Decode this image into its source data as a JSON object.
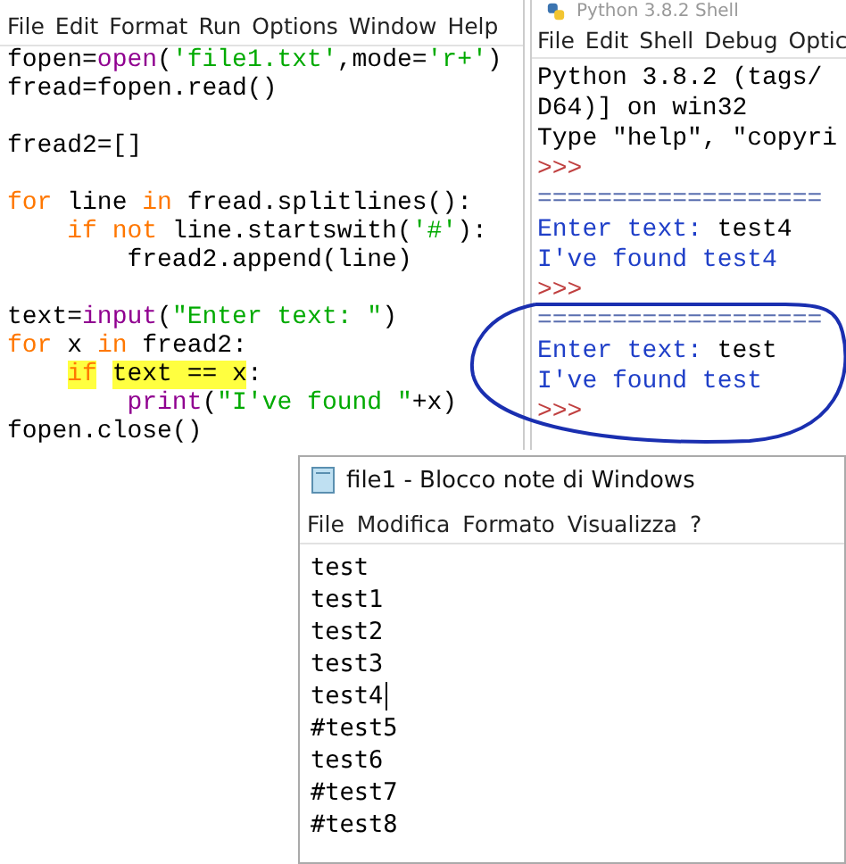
{
  "editor": {
    "menu": [
      "File",
      "Edit",
      "Format",
      "Run",
      "Options",
      "Window",
      "Help"
    ],
    "lines": [
      {
        "segments": [
          {
            "kind": "plain",
            "text": "fopen="
          },
          {
            "kind": "builtin",
            "text": "open"
          },
          {
            "kind": "plain",
            "text": "("
          },
          {
            "kind": "string",
            "text": "'file1.txt'"
          },
          {
            "kind": "plain",
            "text": ",mode="
          },
          {
            "kind": "string",
            "text": "'r+'"
          },
          {
            "kind": "plain",
            "text": ")"
          }
        ]
      },
      {
        "segments": [
          {
            "kind": "plain",
            "text": "fread=fopen.read()"
          }
        ]
      },
      {
        "gap_before": true,
        "segments": [
          {
            "kind": "plain",
            "text": "fread2=[]"
          }
        ]
      },
      {
        "gap_before": true,
        "segments": [
          {
            "kind": "keyword",
            "text": "for"
          },
          {
            "kind": "plain",
            "text": " line "
          },
          {
            "kind": "keyword",
            "text": "in"
          },
          {
            "kind": "plain",
            "text": " fread.splitlines():"
          }
        ]
      },
      {
        "segments": [
          {
            "kind": "keyword",
            "text": "    if not"
          },
          {
            "kind": "plain",
            "text": " line.startswith("
          },
          {
            "kind": "string",
            "text": "'#'"
          },
          {
            "kind": "plain",
            "text": "):"
          }
        ]
      },
      {
        "segments": [
          {
            "kind": "plain",
            "text": "        fread2.append(line)"
          }
        ]
      },
      {
        "gap_before": true,
        "segments": [
          {
            "kind": "plain",
            "text": "text="
          },
          {
            "kind": "builtin",
            "text": "input"
          },
          {
            "kind": "plain",
            "text": "("
          },
          {
            "kind": "string",
            "text": "\"Enter text: \""
          },
          {
            "kind": "plain",
            "text": ")"
          }
        ]
      },
      {
        "segments": [
          {
            "kind": "keyword",
            "text": "for"
          },
          {
            "kind": "plain",
            "text": " x "
          },
          {
            "kind": "keyword",
            "text": "in"
          },
          {
            "kind": "plain",
            "text": " fread2:"
          }
        ]
      },
      {
        "segments": [
          {
            "kind": "keyword",
            "text": "    if",
            "highlighted": true
          },
          {
            "kind": "plain",
            "text": " text == x",
            "highlighted": true
          },
          {
            "kind": "plain",
            "text": ":"
          }
        ]
      },
      {
        "segments": [
          {
            "kind": "builtin",
            "text": "        print"
          },
          {
            "kind": "plain",
            "text": "("
          },
          {
            "kind": "string",
            "text": "\"I've found \""
          },
          {
            "kind": "plain",
            "text": "+x)"
          }
        ]
      },
      {
        "segments": [
          {
            "kind": "plain",
            "text": "fopen.close()"
          }
        ]
      }
    ]
  },
  "shell": {
    "title": "Python 3.8.2 Shell",
    "menu": [
      "File",
      "Edit",
      "Shell",
      "Debug",
      "Optic"
    ],
    "lines": [
      {
        "segments": [
          {
            "kind": "plain",
            "text": "Python 3.8.2 (tags/"
          }
        ]
      },
      {
        "segments": [
          {
            "kind": "plain",
            "text": "D64)] on win32"
          }
        ]
      },
      {
        "segments": [
          {
            "kind": "plain",
            "text": "Type \"help\", \"copyri"
          }
        ]
      },
      {
        "segments": [
          {
            "kind": "prompt",
            "text": ">>>"
          }
        ]
      },
      {
        "segments": [
          {
            "kind": "separator",
            "text": "==================="
          }
        ]
      },
      {
        "segments": [
          {
            "kind": "output",
            "text": "Enter text: "
          },
          {
            "kind": "plain",
            "text": "test4"
          }
        ]
      },
      {
        "segments": [
          {
            "kind": "output",
            "text": "I've found test4"
          }
        ]
      },
      {
        "segments": [
          {
            "kind": "prompt",
            "text": ">>>"
          }
        ]
      },
      {
        "segments": [
          {
            "kind": "separator",
            "text": "==================="
          }
        ]
      },
      {
        "segments": [
          {
            "kind": "output",
            "text": "Enter text: "
          },
          {
            "kind": "plain",
            "text": "test"
          }
        ]
      },
      {
        "segments": [
          {
            "kind": "output",
            "text": "I've found test"
          }
        ]
      },
      {
        "segments": [
          {
            "kind": "prompt",
            "text": ">>>"
          }
        ]
      }
    ]
  },
  "notepad": {
    "title": "file1 - Blocco note di Windows",
    "menu": [
      "File",
      "Modifica",
      "Formato",
      "Visualizza",
      "?"
    ],
    "lines": [
      "test",
      "test1",
      "test2",
      "test3",
      "test4",
      "#test5",
      "test6",
      "#test7",
      "#test8"
    ]
  }
}
